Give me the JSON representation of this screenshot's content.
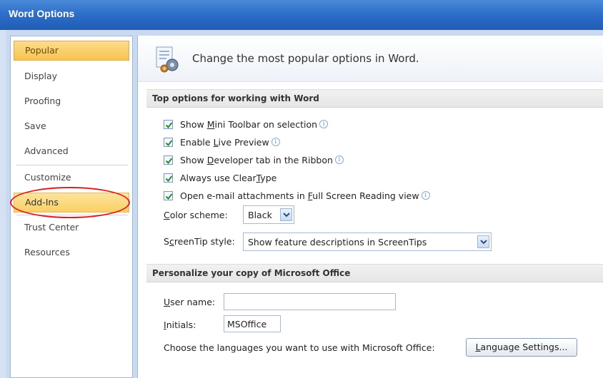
{
  "window": {
    "title": "Word Options"
  },
  "sidebar": {
    "items": [
      {
        "label": "Popular"
      },
      {
        "label": "Display"
      },
      {
        "label": "Proofing"
      },
      {
        "label": "Save"
      },
      {
        "label": "Advanced"
      },
      {
        "label": "Customize"
      },
      {
        "label": "Add-Ins"
      },
      {
        "label": "Trust Center"
      },
      {
        "label": "Resources"
      }
    ]
  },
  "header": {
    "text": "Change the most popular options in Word."
  },
  "top_options": {
    "title": "Top options for working with Word",
    "checks": [
      {
        "pre": "Show ",
        "u": "M",
        "post": "ini Toolbar on selection",
        "info": true,
        "checked": true
      },
      {
        "pre": "Enable ",
        "u": "L",
        "post": "ive Preview",
        "info": true,
        "checked": true
      },
      {
        "pre": "Show ",
        "u": "D",
        "post": "eveloper tab in the Ribbon",
        "info": true,
        "checked": true
      },
      {
        "pre": "Always use Clear",
        "u": "T",
        "post": "ype",
        "info": false,
        "checked": true
      },
      {
        "pre": "Open e-mail attachments in ",
        "u": "F",
        "post": "ull Screen Reading view",
        "info": true,
        "checked": true
      }
    ],
    "color_scheme": {
      "label_u": "C",
      "label_rest": "olor scheme:",
      "value": "Black"
    },
    "screentip": {
      "label_pre": "S",
      "label_u": "c",
      "label_rest": "reenTip style:",
      "value": "Show feature descriptions in ScreenTips"
    }
  },
  "personalize": {
    "title": "Personalize your copy of Microsoft Office",
    "user_name": {
      "label_u": "U",
      "label_rest": "ser name:",
      "value": ""
    },
    "initials": {
      "label_u": "I",
      "label_rest": "nitials:",
      "value": "MSOffice"
    },
    "languages_text": "Choose the languages you want to use with Microsoft Office:",
    "language_button": {
      "u": "L",
      "rest": "anguage Settings..."
    }
  },
  "colors": {
    "titlebar": "#2e6fca",
    "selected_nav": "#f8c44e",
    "highlight": "#d42020",
    "check": "#2a8a2a"
  },
  "info_glyph": "i"
}
